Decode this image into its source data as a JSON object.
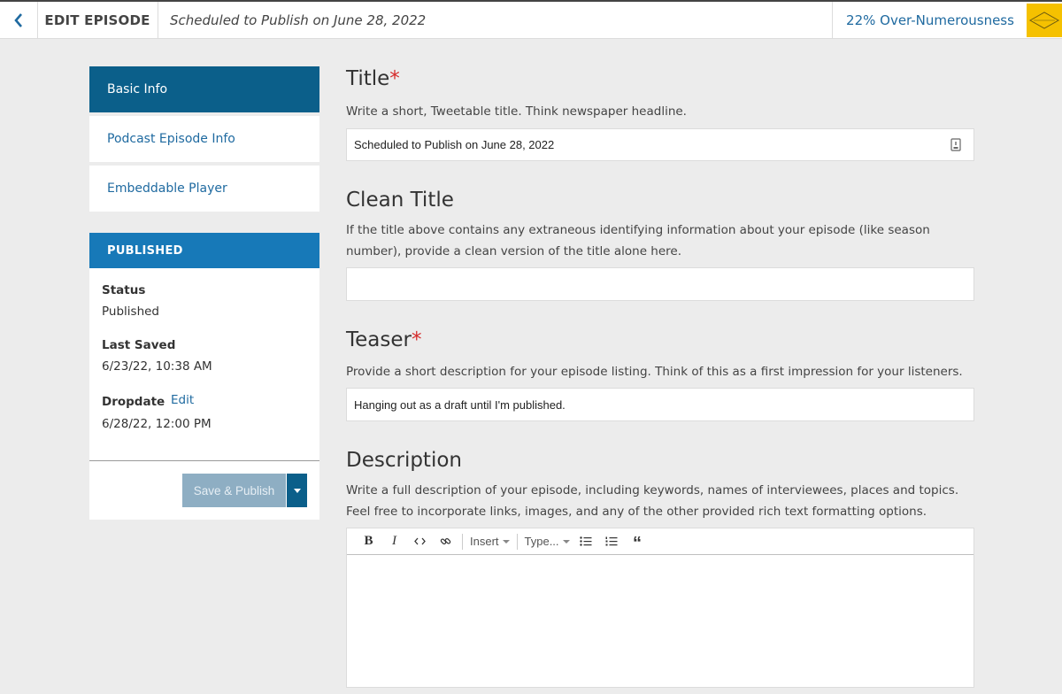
{
  "header": {
    "back_icon": "chevron-left-icon",
    "edit_label": "EDIT EPISODE",
    "subtitle": "Scheduled to Publish on June 28, 2022",
    "series_name": "22% Over-Numerousness",
    "accent": "#1f6aa0",
    "logo_bg": "#f5c100"
  },
  "sidebar": {
    "nav": [
      {
        "label": "Basic Info",
        "active": true
      },
      {
        "label": "Podcast Episode Info",
        "active": false
      },
      {
        "label": "Embeddable Player",
        "active": false
      }
    ],
    "status_panel": {
      "header": "PUBLISHED",
      "status_label": "Status",
      "status_value": "Published",
      "saved_label": "Last Saved",
      "saved_value": "6/23/22, 10:38 AM",
      "dropdate_label": "Dropdate",
      "dropdate_edit": "Edit",
      "dropdate_value": "6/28/22, 12:00 PM",
      "publish_button": "Save & Publish"
    }
  },
  "form": {
    "title": {
      "label": "Title",
      "required_mark": "*",
      "help": "Write a short, Tweetable title. Think newspaper headline.",
      "value": "Scheduled to Publish on June 28, 2022"
    },
    "clean_title": {
      "label": "Clean Title",
      "help": "If the title above contains any extraneous identifying information about your episode (like season number), provide a clean version of the title alone here.",
      "value": ""
    },
    "teaser": {
      "label": "Teaser",
      "required_mark": "*",
      "help": "Provide a short description for your episode listing. Think of this as a first impression for your listeners.",
      "value": "Hanging out as a draft until I'm published."
    },
    "description": {
      "label": "Description",
      "help": "Write a full description of your episode, including keywords, names of interviewees, places and topics. Feel free to incorporate links, images, and any of the other provided rich text formatting options.",
      "toolbar": {
        "bold": "B",
        "italic": "I",
        "insert": "Insert",
        "type": "Type...",
        "quote": "“"
      },
      "value": ""
    }
  }
}
